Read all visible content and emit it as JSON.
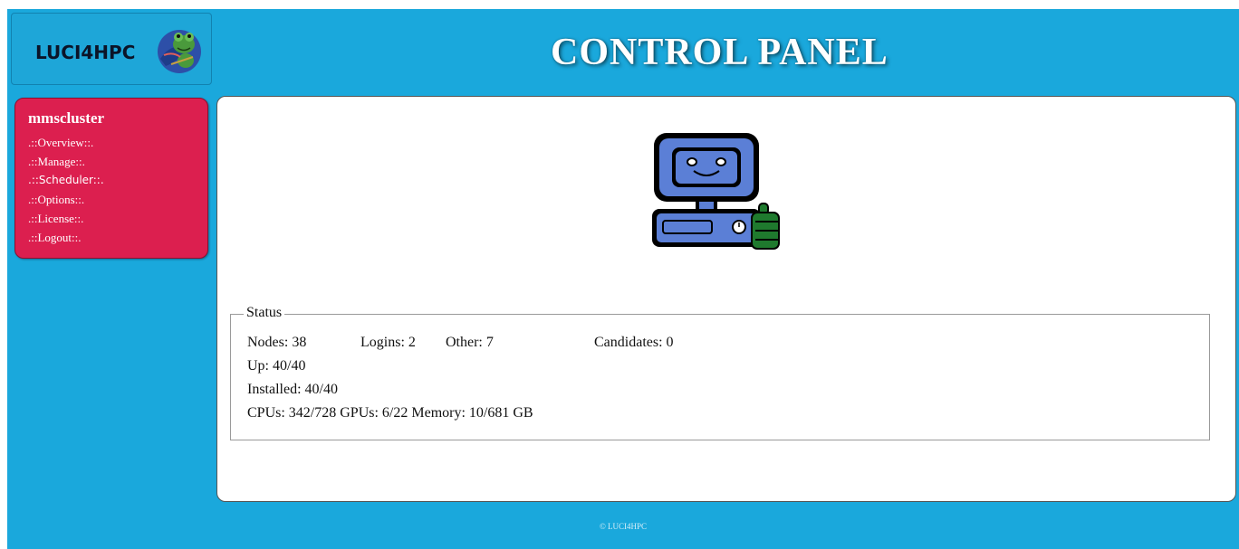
{
  "header": {
    "logo_text": "LUCI4HPC",
    "title": "CONTROL PANEL"
  },
  "sidebar": {
    "cluster_name": "mmscluster",
    "items": [
      {
        "label": ".::Overview::."
      },
      {
        "label": ".::Manage::."
      },
      {
        "label": ".::Scheduler::."
      },
      {
        "label": ".::Options::."
      },
      {
        "label": ".::License::."
      },
      {
        "label": ".::Logout::."
      }
    ]
  },
  "status": {
    "legend": "Status",
    "nodes": "Nodes: 38",
    "logins": "Logins: 2",
    "other": "Other: 7",
    "candidates": "Candidates: 0",
    "up": "Up: 40/40",
    "installed": "Installed: 40/40",
    "resources": "CPUs: 342/728 GPUs: 6/22 Memory: 10/681 GB"
  },
  "footer": {
    "text": "© LUCI4HPC"
  },
  "colors": {
    "background": "#1aa8dc",
    "sidebar": "#dc1f4f",
    "panel": "#ffffff",
    "mascot_body": "#5b7fd6",
    "thumb": "#1f7a2e"
  },
  "icons": {
    "logo_mascot": "frog-mascot-icon",
    "status_mascot": "computer-thumbs-up-icon"
  }
}
